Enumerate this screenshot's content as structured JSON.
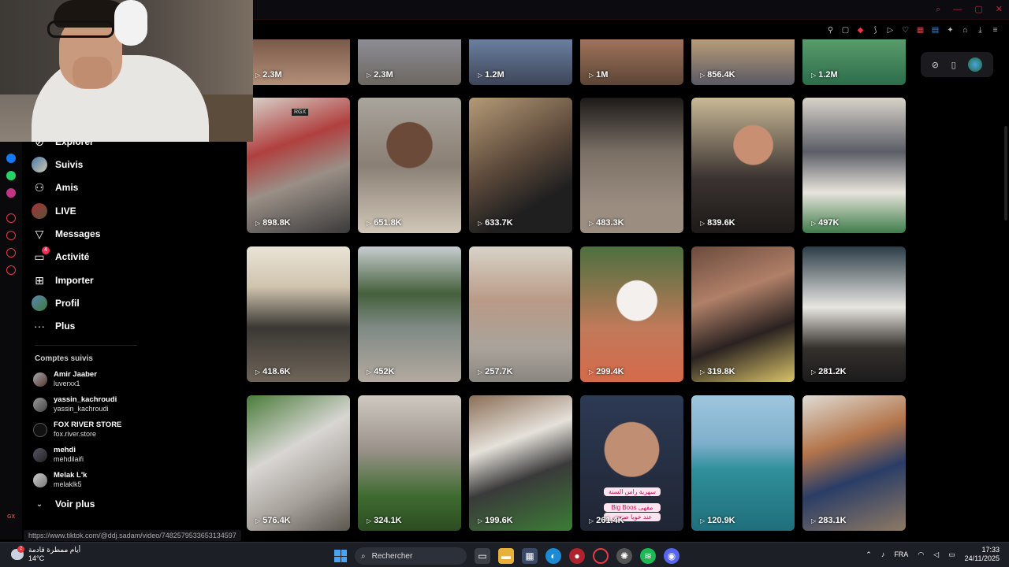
{
  "browser": {
    "window_controls": [
      "⌕",
      "—",
      "▢",
      "✕"
    ],
    "toolbar_icons": [
      "pin-icon",
      "snapshot-icon",
      "shield-icon",
      "translate-icon",
      "play-icon",
      "heart-icon",
      "extension-icon",
      "extension-icon",
      "puzzle-icon",
      "user-icon",
      "download-icon",
      "menu-icon"
    ]
  },
  "sidebar": {
    "nav": [
      {
        "label": "Explorer",
        "icon": "compass-icon"
      },
      {
        "label": "Suivis",
        "icon": "avatar"
      },
      {
        "label": "Amis",
        "icon": "friends-icon"
      },
      {
        "label": "LIVE",
        "icon": "live-icon"
      },
      {
        "label": "Messages",
        "icon": "messages-icon"
      },
      {
        "label": "Activité",
        "icon": "activity-icon",
        "badge": "4"
      },
      {
        "label": "Importer",
        "icon": "upload-icon"
      },
      {
        "label": "Profil",
        "icon": "profile-avatar"
      },
      {
        "label": "Plus",
        "icon": "more-icon"
      }
    ],
    "followed_title": "Comptes suivis",
    "accounts": [
      {
        "name": "Amir Jaaber",
        "handle": "luverxx1"
      },
      {
        "name": "yassin_kachroudi",
        "handle": "yassin_kachroudi"
      },
      {
        "name": "FOX RIVER STORE",
        "handle": "fox.river.store"
      },
      {
        "name": "mehdi",
        "handle": "mehdilaifi"
      },
      {
        "name": "Melak L'k",
        "handle": "melaklk5"
      }
    ],
    "see_more": "Voir plus"
  },
  "videos": {
    "row0": [
      "2.3M",
      "2.3M",
      "1.2M",
      "1M",
      "856.4K",
      "1.2M"
    ],
    "row1": [
      "898.8K",
      "651.8K",
      "633.7K",
      "483.3K",
      "839.6K",
      "497K"
    ],
    "row2": [
      "418.6K",
      "452K",
      "257.7K",
      "299.4K",
      "319.8K",
      "281.2K"
    ],
    "row3": [
      "576.4K",
      "324.1K",
      "199.6K",
      "261.4K",
      "120.9K",
      "283.1K"
    ],
    "overlay_text_1": "سهرية راس السنة",
    "overlay_text_2": "Big Boos مقهى",
    "overlay_text_3": "عند خويا صبحي",
    "tag": "RGX"
  },
  "status_url": "https://www.tiktok.com/@ddj.sadam/video/7482579533653134597",
  "taskbar": {
    "weather_badge": "2",
    "weather_title": "أيام ممطرة قادمة",
    "weather_temp": "14°C",
    "search_placeholder": "Rechercher",
    "language": "FRA",
    "time": "17:33",
    "date": "24/11/2025"
  },
  "colors": {
    "accent": "#fe2c55",
    "opera_red": "#e63947"
  }
}
